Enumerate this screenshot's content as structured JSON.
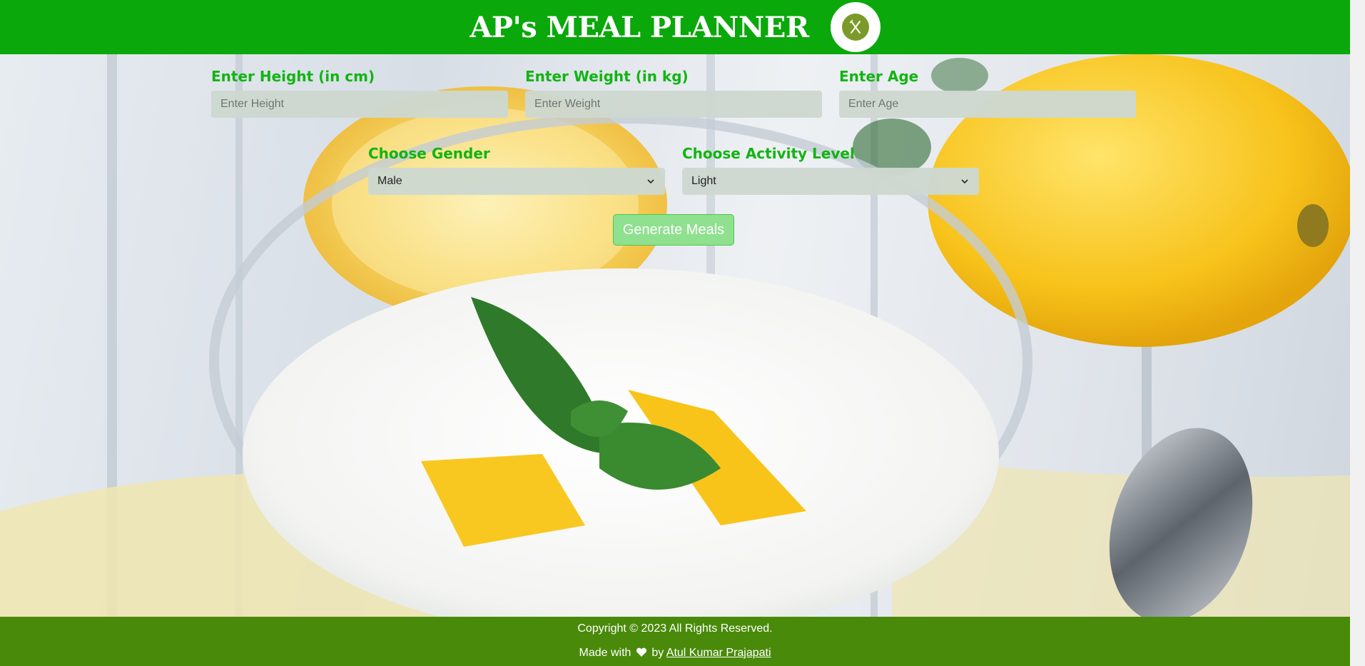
{
  "header": {
    "title": "AP's MEAL PLANNER",
    "logo_icon": "fork-knife-icon"
  },
  "form": {
    "height": {
      "label": "Enter Height (in cm)",
      "placeholder": "Enter Height",
      "value": ""
    },
    "weight": {
      "label": "Enter Weight (in kg)",
      "placeholder": "Enter Weight",
      "value": ""
    },
    "age": {
      "label": "Enter Age",
      "placeholder": "Enter Age",
      "value": ""
    },
    "gender": {
      "label": "Choose Gender",
      "selected": "Male"
    },
    "activity": {
      "label": "Choose Activity Level",
      "selected": "Light"
    },
    "submit_label": "Generate Meals"
  },
  "footer": {
    "copyright": "Copyright © 2023 All Rights Reserved.",
    "made_with": "Made with",
    "by": "by",
    "author": "Atul Kumar Prajapati"
  },
  "colors": {
    "header_bg": "#0aa80a",
    "label_green": "#12b412",
    "footer_bg": "#4a8a0a",
    "button_bg": "#8fe08f"
  }
}
